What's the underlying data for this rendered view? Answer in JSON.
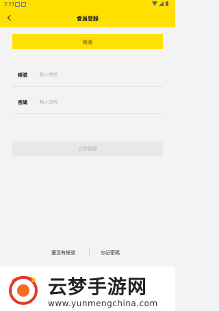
{
  "status": {
    "time": "2:21"
  },
  "header": {
    "title": "會員登錄"
  },
  "tab": {
    "label": "帳號"
  },
  "form": {
    "account": {
      "label": "帳號",
      "placeholder": "輸入帳號",
      "value": ""
    },
    "password": {
      "label": "密碼",
      "placeholder": "輸入密碼",
      "value": ""
    }
  },
  "login": {
    "label": "立即登錄"
  },
  "links": {
    "no_account": "還沒有帳號",
    "forgot_password": "忘記密碼"
  },
  "colors": {
    "accent": "#ffe000",
    "background": "#f3f3f3",
    "disabled_button": "#e8e8e8"
  },
  "icons": {
    "back": "chevron-left-icon",
    "wifi": "wifi-icon",
    "signal": "signal-icon",
    "battery": "battery-icon",
    "watermark_logo": "watermark-logo-icon"
  },
  "watermark": {
    "title": "云梦手游网",
    "url": "www.yunmengchina.com"
  }
}
